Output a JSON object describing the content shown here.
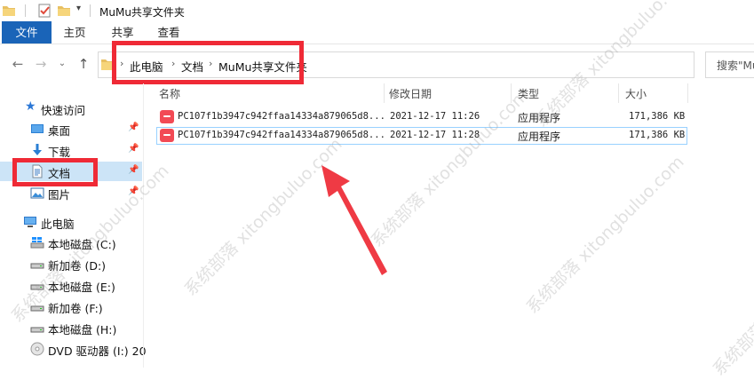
{
  "window": {
    "title": "MuMu共享文件夹"
  },
  "ribbon": {
    "tabs": [
      "文件",
      "主页",
      "共享",
      "查看"
    ]
  },
  "address": {
    "crumbs": [
      "此电脑",
      "文档",
      "MuMu共享文件夹"
    ],
    "search_placeholder": "搜索\"Mu"
  },
  "sidebar": {
    "quick_access": "快速访问",
    "pinned": [
      {
        "label": "桌面",
        "icon": "desktop-icon"
      },
      {
        "label": "下载",
        "icon": "download-icon"
      },
      {
        "label": "文档",
        "icon": "document-icon"
      },
      {
        "label": "图片",
        "icon": "pictures-icon"
      }
    ],
    "this_pc": "此电脑",
    "drives": [
      {
        "label": "本地磁盘 (C:)",
        "icon": "windows-drive-icon"
      },
      {
        "label": "新加卷 (D:)",
        "icon": "drive-icon"
      },
      {
        "label": "本地磁盘 (E:)",
        "icon": "drive-icon"
      },
      {
        "label": "新加卷 (F:)",
        "icon": "drive-icon"
      },
      {
        "label": "本地磁盘 (H:)",
        "icon": "drive-icon"
      },
      {
        "label": "DVD 驱动器 (I:) 20",
        "icon": "dvd-icon"
      }
    ]
  },
  "columns": {
    "name": "名称",
    "modified": "修改日期",
    "type": "类型",
    "size": "大小"
  },
  "files": [
    {
      "name": "PC107f1b3947c942ffaa14334a879065d8...",
      "modified": "2021-12-17 11:26",
      "type": "应用程序",
      "size": "171,386 KB",
      "icon": "mumu-app-icon"
    },
    {
      "name": "PC107f1b3947c942ffaa14334a879065d8...",
      "modified": "2021-12-17 11:28",
      "type": "应用程序",
      "size": "171,386 KB",
      "icon": "mumu-app-icon"
    }
  ],
  "watermark": "系统部落 xitongbuluo.com",
  "colors": {
    "highlight_red": "#ef2a36",
    "file_tab_blue": "#1a64b8",
    "selection_border": "#99d1ff"
  }
}
